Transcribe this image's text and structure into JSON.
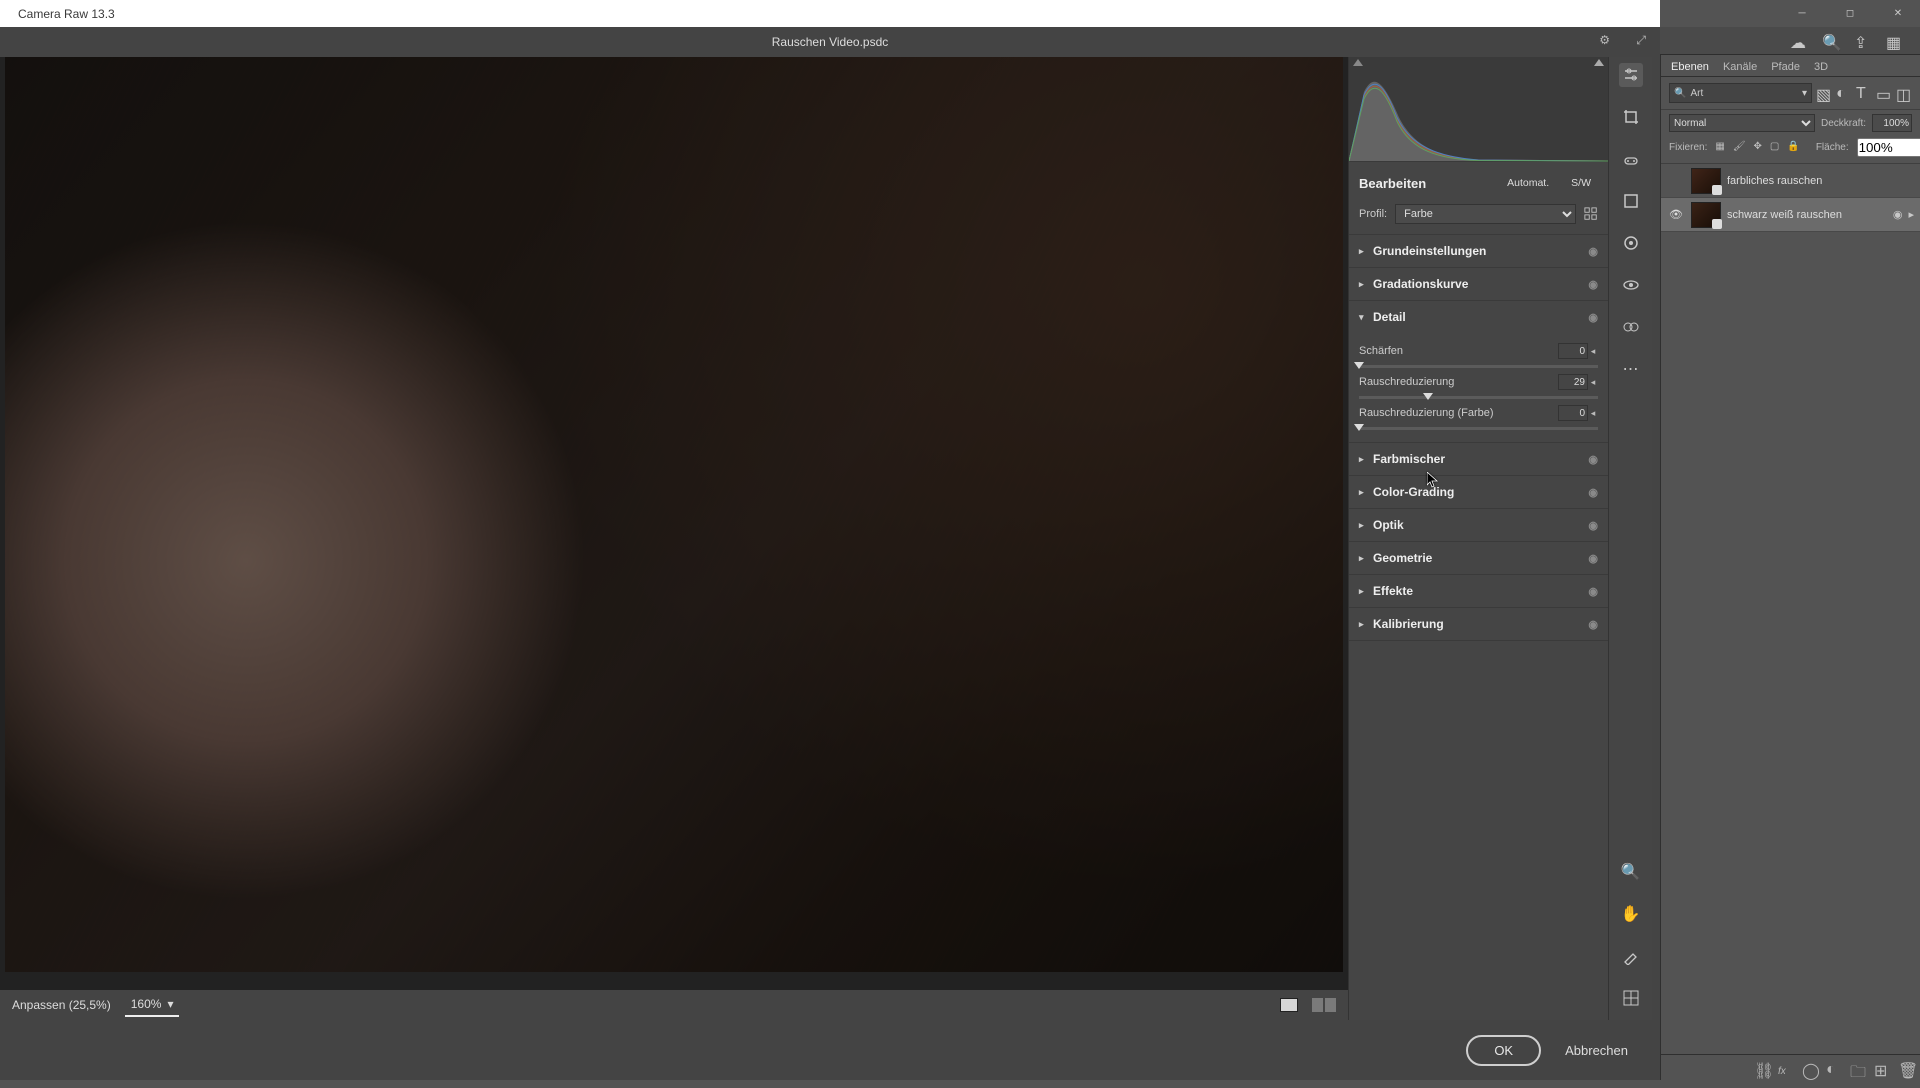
{
  "window": {
    "title": "Camera Raw 13.3"
  },
  "document": {
    "filename": "Rauschen Video.psdc"
  },
  "preview": {
    "fit_label": "Anpassen (25,5%)",
    "zoom_label": "160%"
  },
  "footer": {
    "ok": "OK",
    "cancel": "Abbrechen"
  },
  "edit": {
    "title": "Bearbeiten",
    "auto": "Automat.",
    "bw": "S/W",
    "profile_label": "Profil:",
    "profile_value": "Farbe"
  },
  "panels": {
    "basic": "Grundeinstellungen",
    "curve": "Gradationskurve",
    "detail": {
      "title": "Detail",
      "sharpen": {
        "label": "Schärfen",
        "value": "0",
        "pct": 0
      },
      "nr": {
        "label": "Rauschreduzierung",
        "value": "29",
        "pct": 29
      },
      "nr_color": {
        "label": "Rauschreduzierung (Farbe)",
        "value": "0",
        "pct": 0
      }
    },
    "mixer": "Farbmischer",
    "grading": "Color-Grading",
    "optics": "Optik",
    "geometry": "Geometrie",
    "effects": "Effekte",
    "calibration": "Kalibrierung"
  },
  "ps": {
    "tabs": {
      "layers": "Ebenen",
      "channels": "Kanäle",
      "paths": "Pfade",
      "threeD": "3D"
    },
    "filter_kind": "Art",
    "blend_mode": "Normal",
    "opacity_label": "Deckkraft:",
    "opacity_value": "100%",
    "lock_label": "Fixieren:",
    "fill_label": "Fläche:",
    "fill_value": "100%",
    "layers": [
      {
        "name": "farbliches rauschen",
        "visible": false,
        "selected": false
      },
      {
        "name": "schwarz weiß rauschen",
        "visible": true,
        "selected": true
      }
    ]
  }
}
